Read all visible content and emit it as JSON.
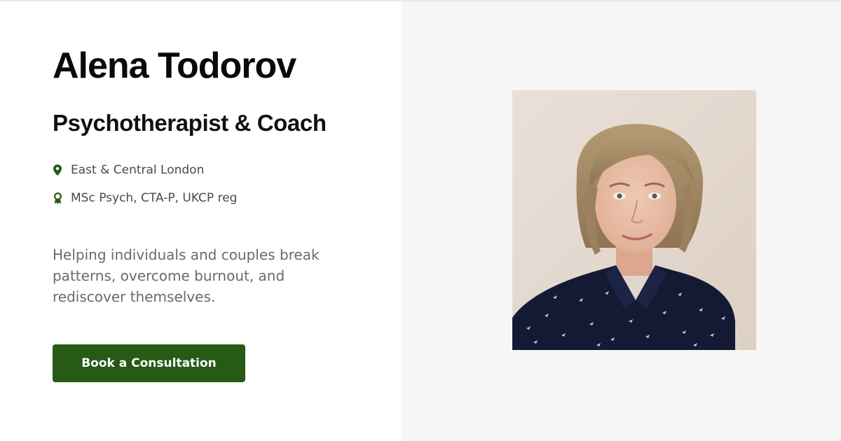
{
  "profile": {
    "name": "Alena Todorov",
    "role": "Psychotherapist & Coach",
    "location": "East & Central London",
    "credentials": "MSc Psych, CTA-P, UKCP reg",
    "tagline": "Helping individuals and couples break patterns, overcome burnout, and rediscover themselves.",
    "cta_label": "Book a Consultation"
  },
  "icons": {
    "location": "map-pin-icon",
    "credentials": "award-ribbon-icon"
  },
  "colors": {
    "accent": "#275a15",
    "heading": "#0a0a0a",
    "body_text": "#4a4a4a",
    "tagline_text": "#6a6a6a",
    "right_panel_bg": "#f6f6f6"
  }
}
